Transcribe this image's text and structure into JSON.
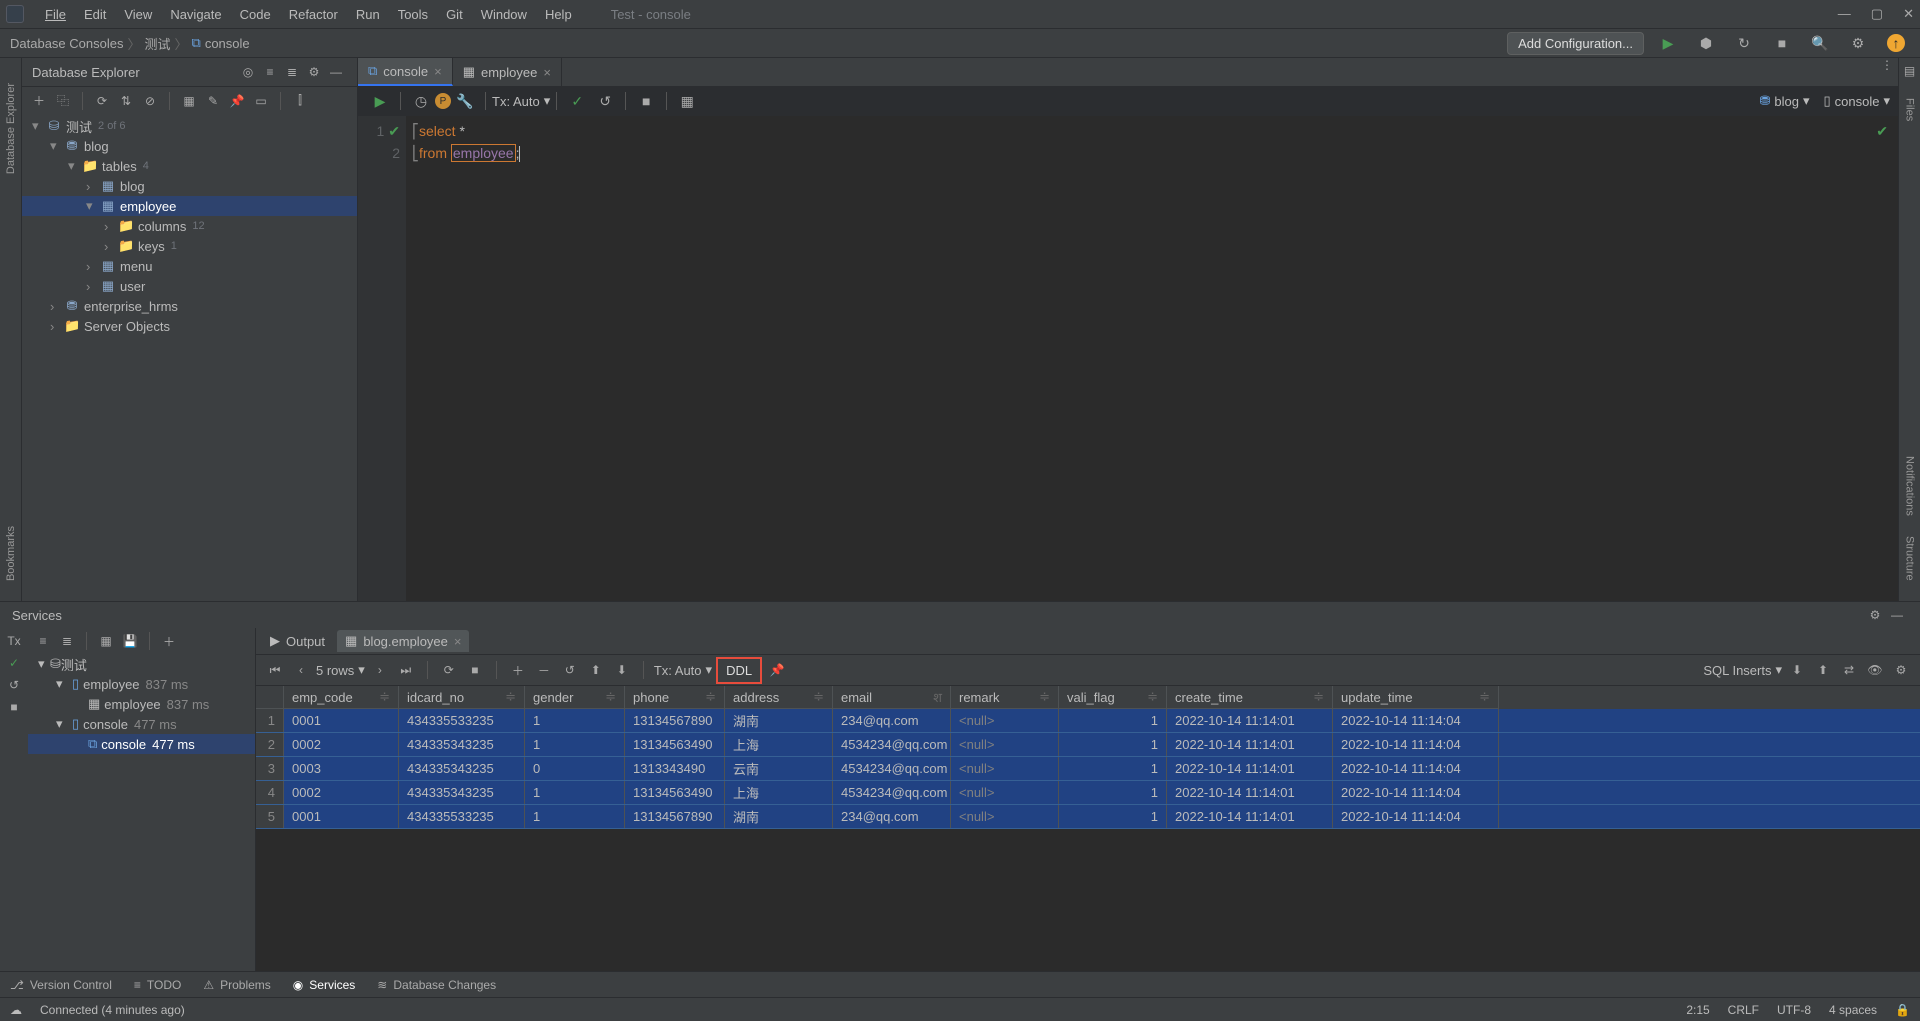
{
  "menu": {
    "items": [
      "File",
      "Edit",
      "View",
      "Navigate",
      "Code",
      "Refactor",
      "Run",
      "Tools",
      "Git",
      "Window",
      "Help"
    ],
    "title": "Test - console"
  },
  "breadcrumb": {
    "a": "Database Consoles",
    "b": "测试",
    "c": "console",
    "addConfig": "Add Configuration..."
  },
  "explorer": {
    "title": "Database Explorer",
    "root": "测试",
    "rootBadge": "2 of 6",
    "blog": "blog",
    "tables": "tables",
    "tablesCount": "4",
    "tblBlog": "blog",
    "tblEmp": "employee",
    "columns": "columns",
    "columnsCount": "12",
    "keys": "keys",
    "keysCount": "1",
    "menu": "menu",
    "user": "user",
    "ent": "enterprise_hrms",
    "svr": "Server Objects"
  },
  "tabs": {
    "console": "console",
    "employee": "employee"
  },
  "editorToolbar": {
    "tx": "Tx: Auto",
    "schema": "blog",
    "session": "console"
  },
  "code": {
    "l1n": "1",
    "l1": "select *",
    "l2n": "2",
    "l2a": "from ",
    "l2b": "employee",
    "l2c": ";"
  },
  "services": {
    "title": "Services",
    "tree": {
      "root": "测试",
      "emp": "employee",
      "empMs": "837 ms",
      "emp2": "employee",
      "emp2Ms": "837 ms",
      "con": "console",
      "conMs": "477 ms",
      "con2": "console",
      "con2Ms": "477 ms"
    },
    "outTab": "Output",
    "resTab": "blog.employee",
    "rows": "5 rows",
    "tx": "Tx: Auto",
    "ddl": "DDL",
    "export": "SQL Inserts"
  },
  "grid": {
    "headers": [
      "emp_code",
      "idcard_no",
      "gender",
      "phone",
      "address",
      "email",
      "remark",
      "vali_flag",
      "create_time",
      "update_time"
    ],
    "rows": [
      [
        "0001",
        "434335533235",
        "1",
        "13134567890",
        "湖南",
        "234@qq.com",
        "<null>",
        "1",
        "2022-10-14 11:14:01",
        "2022-10-14 11:14:04"
      ],
      [
        "0002",
        "434335343235",
        "1",
        "13134563490",
        "上海",
        "4534234@qq.com",
        "<null>",
        "1",
        "2022-10-14 11:14:01",
        "2022-10-14 11:14:04"
      ],
      [
        "0003",
        "434335343235",
        "0",
        "1313343490",
        "云南",
        "4534234@qq.com",
        "<null>",
        "1",
        "2022-10-14 11:14:01",
        "2022-10-14 11:14:04"
      ],
      [
        "0002",
        "434335343235",
        "1",
        "13134563490",
        "上海",
        "4534234@qq.com",
        "<null>",
        "1",
        "2022-10-14 11:14:01",
        "2022-10-14 11:14:04"
      ],
      [
        "0001",
        "434335533235",
        "1",
        "13134567890",
        "湖南",
        "234@qq.com",
        "<null>",
        "1",
        "2022-10-14 11:14:01",
        "2022-10-14 11:14:04"
      ]
    ]
  },
  "footer": {
    "vc": "Version Control",
    "todo": "TODO",
    "problems": "Problems",
    "svc": "Services",
    "dbc": "Database Changes"
  },
  "status": {
    "conn": "Connected (4 minutes ago)",
    "pos": "2:15",
    "eol": "CRLF",
    "enc": "UTF-8",
    "ind": "4 spaces"
  },
  "right": {
    "notif": "Notifications",
    "struct": "Structure",
    "files": "Files"
  },
  "left": {
    "db": "Database Explorer",
    "bm": "Bookmarks"
  }
}
